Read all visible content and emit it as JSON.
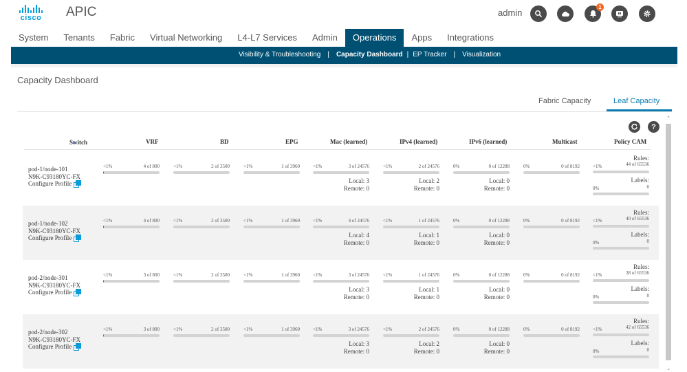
{
  "header": {
    "brand": "cisco",
    "app_title": "APIC",
    "user": "admin",
    "notification_count": "1",
    "icons": [
      "search-icon",
      "cloud-icon",
      "bell-icon",
      "monitor-icon",
      "gear-icon"
    ]
  },
  "main_nav": {
    "tabs": [
      {
        "label": "System",
        "active": false
      },
      {
        "label": "Tenants",
        "active": false
      },
      {
        "label": "Fabric",
        "active": false
      },
      {
        "label": "Virtual Networking",
        "active": false
      },
      {
        "label": "L4-L7 Services",
        "active": false
      },
      {
        "label": "Admin",
        "active": false
      },
      {
        "label": "Operations",
        "active": true
      },
      {
        "label": "Apps",
        "active": false
      },
      {
        "label": "Integrations",
        "active": false
      }
    ]
  },
  "sub_nav": {
    "items": [
      {
        "label": "Visibility & Troubleshooting",
        "active": false
      },
      {
        "label": "Capacity Dashboard",
        "active": true
      },
      {
        "label": "EP Tracker",
        "active": false
      },
      {
        "label": "Visualization",
        "active": false
      }
    ],
    "separator": "|"
  },
  "page": {
    "title": "Capacity Dashboard",
    "tabs": [
      {
        "label": "Fabric Capacity",
        "active": false
      },
      {
        "label": "Leaf Capacity",
        "active": true
      }
    ],
    "toolbar": {
      "refresh_icon": "refresh-icon",
      "help_icon": "help-icon"
    }
  },
  "table": {
    "columns": [
      "Switch",
      "VRF",
      "BD",
      "EPG",
      "Mac (learned)",
      "IPv4 (learned)",
      "IPv6 (learned)",
      "Multicast",
      "Policy CAM"
    ],
    "sort_column": "Switch",
    "sort_direction": "ascending",
    "configure_label": "Configure Profile",
    "rules_label": "Rules:",
    "labels_label": "Labels:",
    "rows": [
      {
        "switch": "pod-1/node-101",
        "model": "N9K-C93180YC-FX",
        "vrf": {
          "pct": "<1%",
          "count": "4 of 800",
          "fill": 0.005
        },
        "bd": {
          "pct": "<1%",
          "count": "2 of 3500",
          "fill": 0.0006
        },
        "epg": {
          "pct": "<1%",
          "count": "1 of 3960",
          "fill": 0.0003
        },
        "mac": {
          "pct": "<1%",
          "count": "3 of 24576",
          "fill": 0.0001,
          "local": "Local: 3",
          "remote": "Remote: 0"
        },
        "ipv4": {
          "pct": "<1%",
          "count": "2 of 24576",
          "fill": 0.0001,
          "local": "Local: 2",
          "remote": "Remote: 0"
        },
        "ipv6": {
          "pct": "0%",
          "count": "0 of 12288",
          "fill": 0,
          "local": "Local: 0",
          "remote": "Remote: 0"
        },
        "multicast": {
          "pct": "0%",
          "count": "0 of 8192",
          "fill": 0
        },
        "rules": {
          "pct": "<1%",
          "count": "44 of 65536",
          "fill": 0.0007
        },
        "labels": {
          "pct": "0%",
          "count": "0",
          "fill": 0
        }
      },
      {
        "switch": "pod-1/node-102",
        "model": "N9K-C93180YC-FX",
        "vrf": {
          "pct": "<1%",
          "count": "4 of 800",
          "fill": 0.005
        },
        "bd": {
          "pct": "<1%",
          "count": "2 of 3500",
          "fill": 0.0006
        },
        "epg": {
          "pct": "<1%",
          "count": "1 of 3960",
          "fill": 0.0003
        },
        "mac": {
          "pct": "<1%",
          "count": "4 of 24576",
          "fill": 0.0002,
          "local": "Local: 4",
          "remote": "Remote: 0"
        },
        "ipv4": {
          "pct": "<1%",
          "count": "1 of 24576",
          "fill": 4e-05,
          "local": "Local: 1",
          "remote": "Remote: 0"
        },
        "ipv6": {
          "pct": "0%",
          "count": "0 of 12288",
          "fill": 0,
          "local": "Local: 0",
          "remote": "Remote: 0"
        },
        "multicast": {
          "pct": "0%",
          "count": "0 of 8192",
          "fill": 0
        },
        "rules": {
          "pct": "<1%",
          "count": "40 of 65536",
          "fill": 0.0006
        },
        "labels": {
          "pct": "0%",
          "count": "0",
          "fill": 0
        }
      },
      {
        "switch": "pod-2/node-301",
        "model": "N9K-C93180YC-FX",
        "vrf": {
          "pct": "<1%",
          "count": "3 of 800",
          "fill": 0.004
        },
        "bd": {
          "pct": "<1%",
          "count": "2 of 3500",
          "fill": 0.0006
        },
        "epg": {
          "pct": "<1%",
          "count": "1 of 3960",
          "fill": 0.0003
        },
        "mac": {
          "pct": "<1%",
          "count": "3 of 24576",
          "fill": 0.0001,
          "local": "Local: 3",
          "remote": "Remote: 0"
        },
        "ipv4": {
          "pct": "<1%",
          "count": "1 of 24576",
          "fill": 4e-05,
          "local": "Local: 1",
          "remote": "Remote: 0"
        },
        "ipv6": {
          "pct": "0%",
          "count": "0 of 12288",
          "fill": 0,
          "local": "Local: 0",
          "remote": "Remote: 0"
        },
        "multicast": {
          "pct": "0%",
          "count": "0 of 8192",
          "fill": 0
        },
        "rules": {
          "pct": "<1%",
          "count": "38 of 65536",
          "fill": 0.0006
        },
        "labels": {
          "pct": "0%",
          "count": "0",
          "fill": 0
        }
      },
      {
        "switch": "pod-2/node-302",
        "model": "N9K-C93180YC-FX",
        "vrf": {
          "pct": "<1%",
          "count": "3 of 800",
          "fill": 0.004
        },
        "bd": {
          "pct": "<1%",
          "count": "2 of 3500",
          "fill": 0.0006
        },
        "epg": {
          "pct": "<1%",
          "count": "1 of 3960",
          "fill": 0.0003
        },
        "mac": {
          "pct": "<1%",
          "count": "3 of 24576",
          "fill": 0.0001,
          "local": "Local: 3",
          "remote": "Remote: 0"
        },
        "ipv4": {
          "pct": "<1%",
          "count": "2 of 24576",
          "fill": 0.0001,
          "local": "Local: 2",
          "remote": "Remote: 0"
        },
        "ipv6": {
          "pct": "0%",
          "count": "0 of 12288",
          "fill": 0,
          "local": "Local: 0",
          "remote": "Remote: 0"
        },
        "multicast": {
          "pct": "0%",
          "count": "0 of 8192",
          "fill": 0
        },
        "rules": {
          "pct": "<1%",
          "count": "42 of 65536",
          "fill": 0.0006
        },
        "labels": {
          "pct": "0%",
          "count": "0",
          "fill": 0
        }
      }
    ]
  },
  "colors": {
    "brand_blue": "#049fd9",
    "nav_dark": "#005073",
    "tab_active": "#0a7db2",
    "badge": "#f26722",
    "icon_bg": "#4a4a4a",
    "bar_track": "#d3d3d3"
  }
}
